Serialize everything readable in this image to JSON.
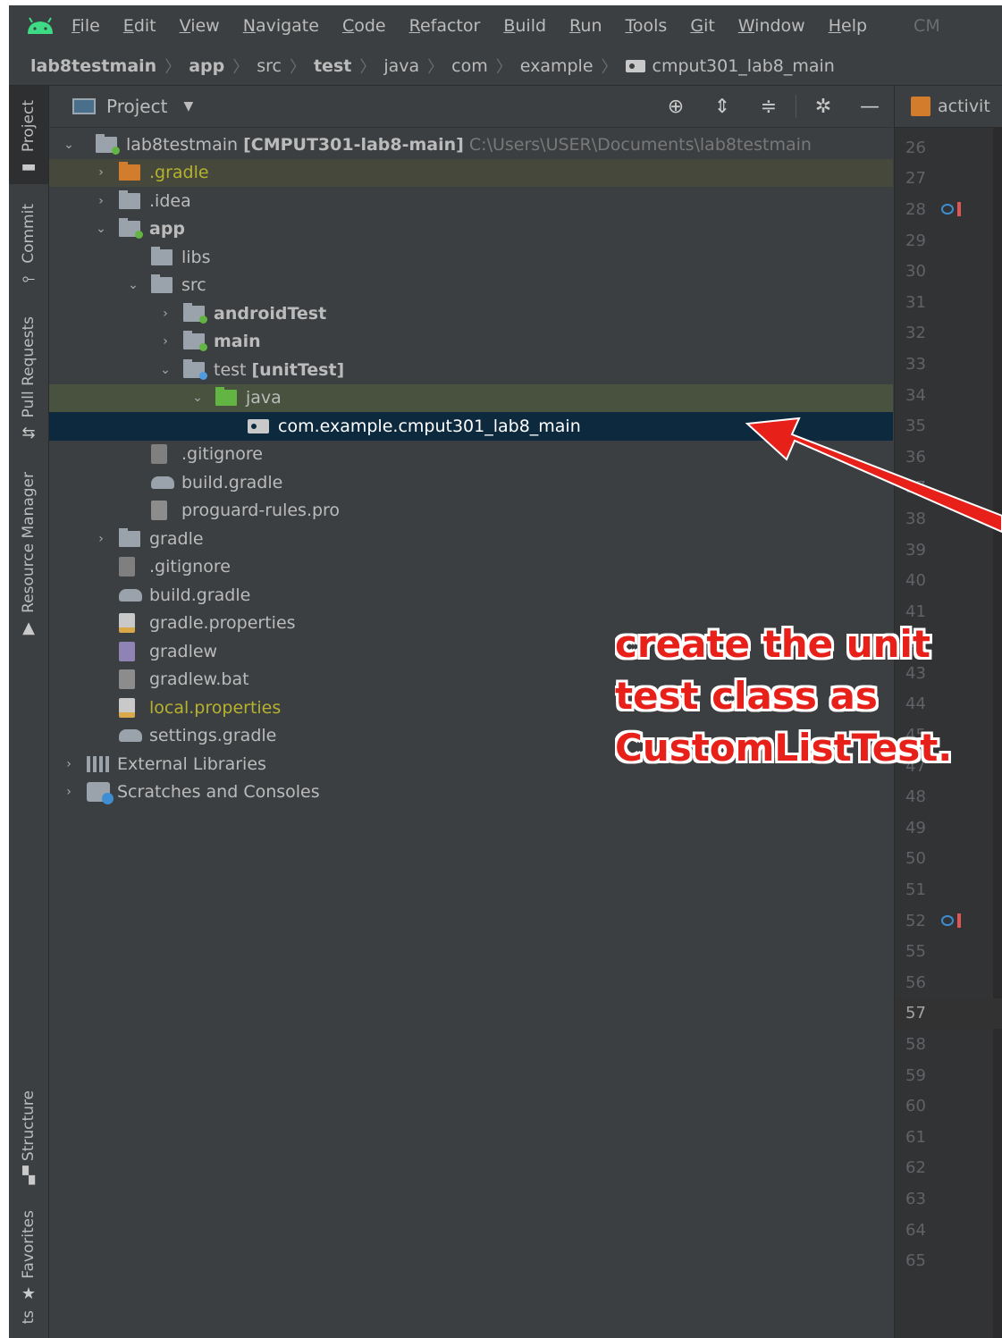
{
  "menu": {
    "items": [
      "File",
      "Edit",
      "View",
      "Navigate",
      "Code",
      "Refactor",
      "Build",
      "Run",
      "Tools",
      "Git",
      "Window",
      "Help"
    ],
    "truncated_title": "CM"
  },
  "breadcrumb": [
    "lab8testmain",
    "app",
    "src",
    "test",
    "java",
    "com",
    "example",
    "cmput301_lab8_main"
  ],
  "left_stripe": {
    "project": "Project",
    "commit": "Commit",
    "pull_requests": "Pull Requests",
    "resource_manager": "Resource Manager",
    "structure": "Structure",
    "favorites": "Favorites",
    "bottom_cut": "ts"
  },
  "project_panel": {
    "title": "Project",
    "tool_icons": [
      "locate-icon",
      "expand-all-icon",
      "collapse-all-icon",
      "gear-icon",
      "hide-icon"
    ],
    "root": {
      "name": "lab8testmain",
      "module": "[CMPUT301-lab8-main]",
      "path": "C:\\Users\\USER\\Documents\\lab8testmain"
    },
    "tree": [
      {
        "label": ".gradle",
        "level": 1,
        "arrow": "collapsed",
        "icon": "folder-orange",
        "style": "yellow",
        "highlight": "olive"
      },
      {
        "label": ".idea",
        "level": 1,
        "arrow": "collapsed",
        "icon": "folder"
      },
      {
        "label": "app",
        "level": 1,
        "arrow": "expanded",
        "icon": "folder-module",
        "bold": true
      },
      {
        "label": "libs",
        "level": 2,
        "arrow": "none",
        "icon": "folder"
      },
      {
        "label": "src",
        "level": 2,
        "arrow": "expanded",
        "icon": "folder"
      },
      {
        "label": "androidTest",
        "level": 3,
        "arrow": "collapsed",
        "icon": "folder-module",
        "bold": true
      },
      {
        "label": "main",
        "level": 3,
        "arrow": "collapsed",
        "icon": "folder-module",
        "bold": true
      },
      {
        "label": "test",
        "level": 3,
        "arrow": "expanded",
        "icon": "folder-test",
        "bold": false,
        "suffix": "[unitTest]"
      },
      {
        "label": "java",
        "level": 4,
        "arrow": "expanded",
        "icon": "folder-green",
        "highlight": "green"
      },
      {
        "label": "com.example.cmput301_lab8_main",
        "level": 5,
        "arrow": "none",
        "icon": "package",
        "selected": true
      },
      {
        "label": ".gitignore",
        "level": 2,
        "arrow": "none",
        "icon": "file-git"
      },
      {
        "label": "build.gradle",
        "level": 2,
        "arrow": "none",
        "icon": "gradle"
      },
      {
        "label": "proguard-rules.pro",
        "level": 2,
        "arrow": "none",
        "icon": "file"
      },
      {
        "label": "gradle",
        "level": 1,
        "arrow": "collapsed",
        "icon": "folder"
      },
      {
        "label": ".gitignore",
        "level": 1,
        "arrow": "none",
        "icon": "file-git"
      },
      {
        "label": "build.gradle",
        "level": 1,
        "arrow": "none",
        "icon": "gradle"
      },
      {
        "label": "gradle.properties",
        "level": 1,
        "arrow": "none",
        "icon": "file-props"
      },
      {
        "label": "gradlew",
        "level": 1,
        "arrow": "none",
        "icon": "file-gradlew"
      },
      {
        "label": "gradlew.bat",
        "level": 1,
        "arrow": "none",
        "icon": "file"
      },
      {
        "label": "local.properties",
        "level": 1,
        "arrow": "none",
        "icon": "file-props",
        "style": "yellow"
      },
      {
        "label": "settings.gradle",
        "level": 1,
        "arrow": "none",
        "icon": "gradle"
      },
      {
        "label": "External Libraries",
        "level": 0,
        "arrow": "collapsed",
        "icon": "ext-libs"
      },
      {
        "label": "Scratches and Consoles",
        "level": 0,
        "arrow": "collapsed",
        "icon": "scratches"
      }
    ]
  },
  "editor": {
    "tab_label": "activit",
    "line_numbers": [
      "26",
      "27",
      "28",
      "29",
      "30",
      "31",
      "32",
      "33",
      "34",
      "35",
      "36",
      "37",
      "38",
      "39",
      "40",
      "41",
      "42",
      "43",
      "44",
      "45",
      "47",
      "48",
      "49",
      "50",
      "51",
      "52",
      "55",
      "56",
      "57",
      "58",
      "59",
      "60",
      "61",
      "62",
      "63",
      "64",
      "65"
    ],
    "current_line": "57",
    "marked_lines": [
      "28",
      "52"
    ]
  },
  "annotation": {
    "text": "create the unit\ntest class as\nCustomListTest.",
    "color": "#e8201a"
  },
  "colors": {
    "selection": "#0d293e",
    "background": "#3c3f41",
    "editor_bg": "#313335"
  }
}
